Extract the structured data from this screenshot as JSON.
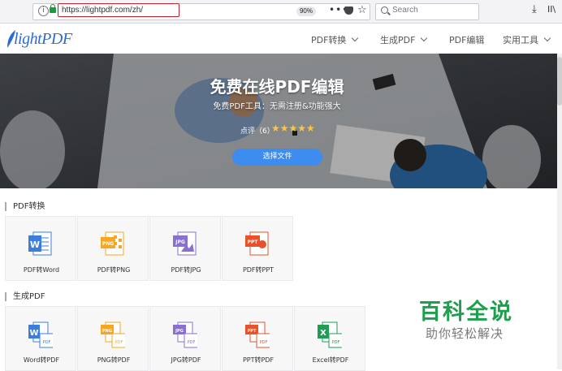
{
  "browser": {
    "url": "https://lightpdf.com/zh/",
    "zoom": "90%",
    "search_placeholder": "Search",
    "more_icon": "•••",
    "bookmark_icon": "☆",
    "download_icon": "⤓",
    "library_icon": "II\\"
  },
  "header": {
    "logo": "lightPDF",
    "nav": [
      {
        "label": "PDF转换"
      },
      {
        "label": "生成PDF"
      },
      {
        "label": "PDF编辑"
      },
      {
        "label": "实用工具"
      }
    ]
  },
  "hero": {
    "title": "免费在线PDF编辑",
    "subtitle": "免费PDF工具：无需注册&功能强大",
    "rating_text": "点评（6）",
    "rating_value": 5,
    "stars": "★★★★★",
    "button_label": "选择文件"
  },
  "sections": [
    {
      "title": "PDF转换",
      "cards": [
        {
          "label": "PDF转Word",
          "icon_text": "W",
          "color": "#3b7ddd"
        },
        {
          "label": "PDF转PNG",
          "icon_text": "PNG",
          "color": "#f5a623"
        },
        {
          "label": "PDF转JPG",
          "icon_text": "JPG",
          "color": "#8b6fd0"
        },
        {
          "label": "PDF转PPT",
          "icon_text": "PPT",
          "color": "#e7522c"
        }
      ]
    },
    {
      "title": "生成PDF",
      "cards": [
        {
          "label": "Word转PDF",
          "icon_text": "W",
          "color": "#3b7ddd",
          "badge": "PDF"
        },
        {
          "label": "PNG转PDF",
          "icon_text": "PNG",
          "color": "#f5a623",
          "badge": "PDF"
        },
        {
          "label": "JPG转PDF",
          "icon_text": "JPG",
          "color": "#8b6fd0",
          "badge": "PDF"
        },
        {
          "label": "PPT转PDF",
          "icon_text": "PPT",
          "color": "#e7522c",
          "badge": "PDF"
        },
        {
          "label": "Excel转PDF",
          "icon_text": "X",
          "color": "#1f9d55",
          "badge": "PDF"
        }
      ]
    }
  ],
  "watermark": {
    "main": "百科全说",
    "sub": "助你轻松解决"
  }
}
